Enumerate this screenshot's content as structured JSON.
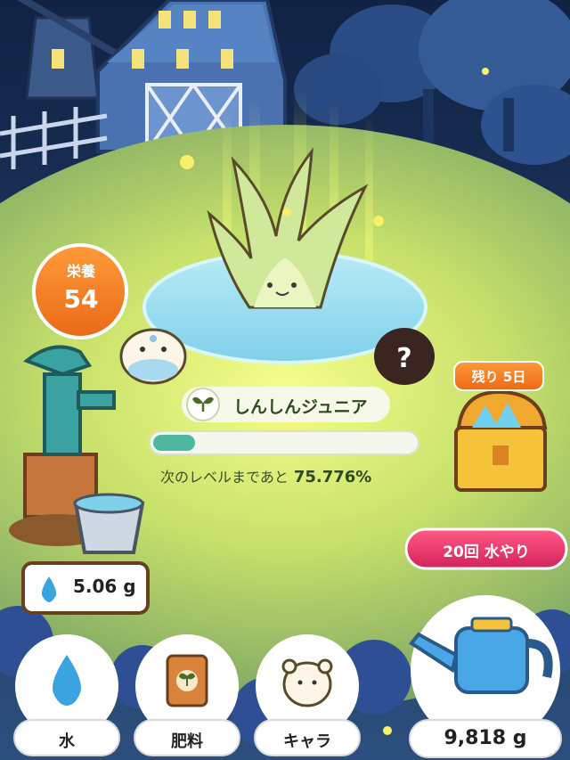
{
  "nutrition": {
    "label": "栄養",
    "value": "54"
  },
  "plant": {
    "name": "しんしんジュニア",
    "level_prefix": "次のレベルまであと",
    "level_percent": "75.776%",
    "level_progress_fraction": 0.16
  },
  "chest": {
    "days_left": "残り 5日"
  },
  "water_button": {
    "label": "20回 水やり"
  },
  "water_amount": {
    "value": "5.06 g",
    "icon": "water-drop-icon"
  },
  "bottom_nav": {
    "water": {
      "label": "水",
      "icon": "water-drop-icon"
    },
    "fertilizer": {
      "label": "肥料",
      "icon": "fertilizer-bag-icon"
    },
    "character": {
      "label": "キャラ",
      "icon": "hamster-icon"
    },
    "watering_can": {
      "value": "9,818 g",
      "icon": "watering-can-icon"
    }
  },
  "colors": {
    "accent_orange": "#f07a1e",
    "accent_pink": "#e8326a",
    "progress_fill": "#4fb7a0",
    "sky": "#16294f",
    "grass": "#c8e06a"
  }
}
